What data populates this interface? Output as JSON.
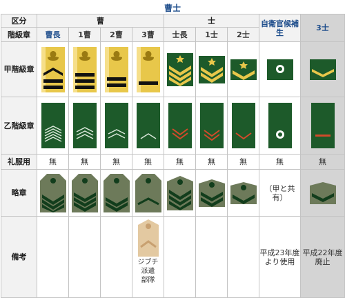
{
  "page_title": "曹士",
  "header": {
    "classification_label": "区分",
    "rank_label": "階級章",
    "group_sgt": "曹",
    "group_pvt": "士",
    "candidate": "自衛官候補生",
    "pvt3": "3士",
    "ranks": [
      "曹長",
      "1曹",
      "2曹",
      "3曹",
      "士長",
      "1士",
      "2士"
    ]
  },
  "rows": {
    "kou": "甲階級章",
    "otsu": "乙階級章",
    "dress": "礼服用",
    "ryaku": "略章",
    "biko": "備考"
  },
  "dress_values": [
    "無",
    "無",
    "無",
    "無",
    "無",
    "無",
    "無",
    "無",
    "無"
  ],
  "ryaku_candidate": "（甲と共有）",
  "notes": {
    "sansou": "ジブチ\n派遣\n部隊",
    "candidate": "平成23年度\nより使用",
    "pvt3": "平成22年度\n廃止"
  },
  "colors": {
    "gold": "#e8c74a",
    "green": "#1d5a2a",
    "dark_green": "#123d1c",
    "khaki": "#6d7a5a",
    "red": "#d24a2a",
    "grey_col": "#d4d4d4",
    "title_blue": "#1f4e8c"
  }
}
